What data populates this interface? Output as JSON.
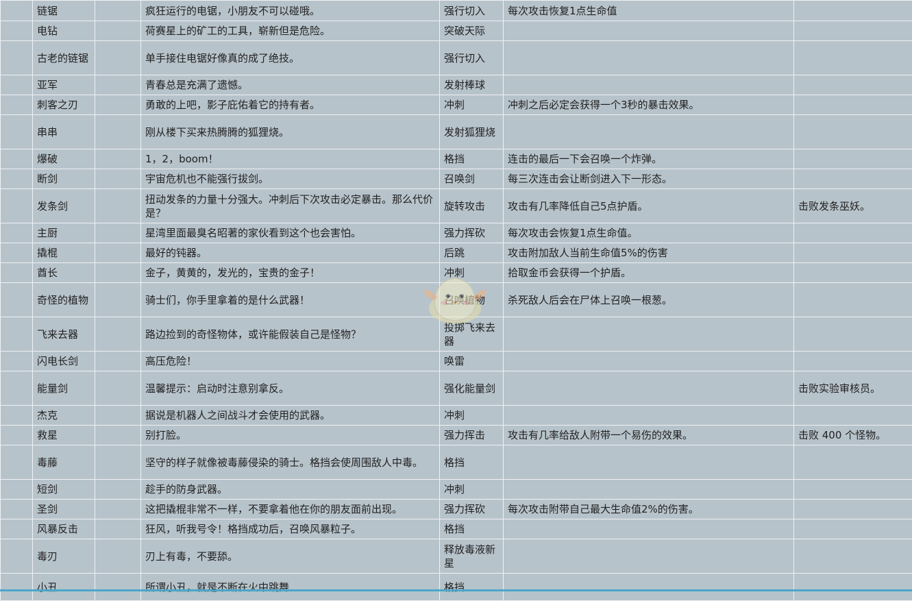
{
  "columns": [
    "blank_left",
    "name",
    "blank_mid",
    "description",
    "skill",
    "effect",
    "unlock"
  ],
  "colors": {
    "cell_background": "#b7c3cb",
    "grid_line": "#eef1f3",
    "text": "#222222",
    "bottom_accent": "#4aa6c8"
  },
  "watermark_icon": "chick-mascot-icon",
  "rows": [
    {
      "name": "链锯",
      "description": "疯狂运行的电锯，小朋友不可以碰哦。",
      "skill": "强行切入",
      "effect": "每次攻击恢复1点生命值",
      "unlock": ""
    },
    {
      "name": "电钻",
      "description": "荷赛星上的矿工的工具，崭新但是危险。",
      "skill": "突破天际",
      "effect": "",
      "unlock": ""
    },
    {
      "name": "古老的链锯",
      "description": "单手接住电锯好像真的成了绝技。",
      "skill": "强行切入",
      "effect": "",
      "unlock": ""
    },
    {
      "name": "亚军",
      "description": "青春总是充满了遗憾。",
      "skill": "发射棒球",
      "effect": "",
      "unlock": ""
    },
    {
      "name": "刺客之刃",
      "description": "勇敢的上吧，影子庇佑着它的持有者。",
      "skill": "冲刺",
      "effect": "冲刺之后必定会获得一个3秒的暴击效果。",
      "unlock": ""
    },
    {
      "name": "串串",
      "description": "刚从楼下买来热腾腾的狐狸烧。",
      "skill": "发射狐狸烧",
      "effect": "",
      "unlock": ""
    },
    {
      "name": "爆破",
      "description": "1，2，boom！",
      "skill": "格挡",
      "effect": "连击的最后一下会召唤一个炸弹。",
      "unlock": ""
    },
    {
      "name": "断剑",
      "description": "宇宙危机也不能强行拔剑。",
      "skill": "召唤剑",
      "effect": "每三次连击会让断剑进入下一形态。",
      "unlock": ""
    },
    {
      "name": "发条剑",
      "description": "扭动发条的力量十分强大。冲刺后下次攻击必定暴击。那么代价是？",
      "skill": "旋转攻击",
      "effect": "攻击有几率降低自己5点护盾。",
      "unlock": "击败发条巫妖。"
    },
    {
      "name": "主厨",
      "description": "星湾里面最臭名昭著的家伙看到这个也会害怕。",
      "skill": "强力挥砍",
      "effect": "每次攻击会恢复1点生命值。",
      "unlock": ""
    },
    {
      "name": "撬棍",
      "description": "最好的钝器。",
      "skill": "后跳",
      "effect": "攻击附加敌人当前生命值5%的伤害",
      "unlock": ""
    },
    {
      "name": "酋长",
      "description": "金子，黄黄的，发光的，宝贵的金子！",
      "skill": "冲刺",
      "effect": "拾取金币会获得一个护盾。",
      "unlock": ""
    },
    {
      "name": "奇怪的植物",
      "description": "骑士们，你手里拿着的是什么武器！",
      "skill": "召唤植物",
      "effect": "杀死敌人后会在尸体上召唤一根葱。",
      "unlock": ""
    },
    {
      "name": "飞来去器",
      "description": "路边捡到的奇怪物体，或许能假装自己是怪物？",
      "skill": "投掷飞来去器",
      "effect": "",
      "unlock": ""
    },
    {
      "name": "闪电长剑",
      "description": "高压危险！",
      "skill": "唤雷",
      "effect": "",
      "unlock": ""
    },
    {
      "name": "能量剑",
      "description": "温馨提示：启动时注意别拿反。",
      "skill": "强化能量剑",
      "effect": "",
      "unlock": "击败实验审核员。"
    },
    {
      "name": "杰克",
      "description": "据说是机器人之间战斗才会使用的武器。",
      "skill": "冲刺",
      "effect": "",
      "unlock": ""
    },
    {
      "name": "救星",
      "description": "别打脸。",
      "skill": "强力挥击",
      "effect": "攻击有几率给敌人附带一个易伤的效果。",
      "unlock": "击败 400 个怪物。"
    },
    {
      "name": "毒藤",
      "description": "坚守的样子就像被毒藤侵染的骑士。格挡会使周围敌人中毒。",
      "skill": "格挡",
      "effect": "",
      "unlock": ""
    },
    {
      "name": "短剑",
      "description": "趁手的防身武器。",
      "skill": "冲刺",
      "effect": "",
      "unlock": ""
    },
    {
      "name": "圣剑",
      "description": "这把撬棍非常不一样，不要拿着他在你的朋友面前出现。",
      "skill": "强力挥砍",
      "effect": "每次攻击附带自己最大生命值2%的伤害。",
      "unlock": ""
    },
    {
      "name": "风暴反击",
      "description": "狂风，听我号令！格挡成功后，召唤风暴粒子。",
      "skill": "格挡",
      "effect": "",
      "unlock": ""
    },
    {
      "name": "毒刃",
      "description": "刃上有毒，不要舔。",
      "skill": "释放毒液新星",
      "effect": "",
      "unlock": ""
    },
    {
      "name": "小丑",
      "description": "所谓小丑，就是不断在火中跳舞",
      "skill": "格挡",
      "effect": "",
      "unlock": ""
    }
  ]
}
